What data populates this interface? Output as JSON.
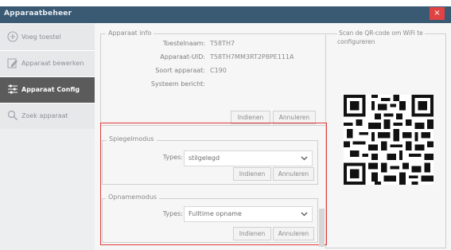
{
  "window": {
    "title": "Apparaatbeheer",
    "close_glyph": "×"
  },
  "sidebar": {
    "items": [
      {
        "label": "Voeg toestel",
        "icon": "plus-circle-icon"
      },
      {
        "label": "Apparaat bewerken",
        "icon": "edit-icon"
      },
      {
        "label": "Apparaat Config",
        "icon": "settings-sliders-icon"
      },
      {
        "label": "Zoek apparaat",
        "icon": "search-icon"
      }
    ]
  },
  "device_info": {
    "legend": "Apparaat info",
    "fields": [
      {
        "label": "Toestelnaam:",
        "value": "T58TH7"
      },
      {
        "label": "Apparaat-UID:",
        "value": "T58TH7MM3RT2P8PE111A"
      },
      {
        "label": "Soort apparaat:",
        "value": "C190"
      },
      {
        "label": "Systeem bericht:",
        "value": ""
      }
    ],
    "submit_label": "Indienen",
    "cancel_label": "Annuleren"
  },
  "mirror_mode": {
    "legend": "Spiegelmodus",
    "type_label": "Types:",
    "selected": "stilgelegd",
    "submit_label": "Indienen",
    "cancel_label": "Annuleren"
  },
  "record_mode": {
    "legend": "Opnamemodus",
    "type_label": "Types:",
    "selected": "Fulltime opname",
    "submit_label": "Indienen",
    "cancel_label": "Annuleren"
  },
  "qr_panel": {
    "text_line1": "Scan de QR-code om WiFi te",
    "text_line2": "configureren"
  },
  "colors": {
    "titlebar": "#3a5a74",
    "close": "#e04343",
    "highlight": "#e03a3a",
    "active_item": "#5b5b5b"
  }
}
